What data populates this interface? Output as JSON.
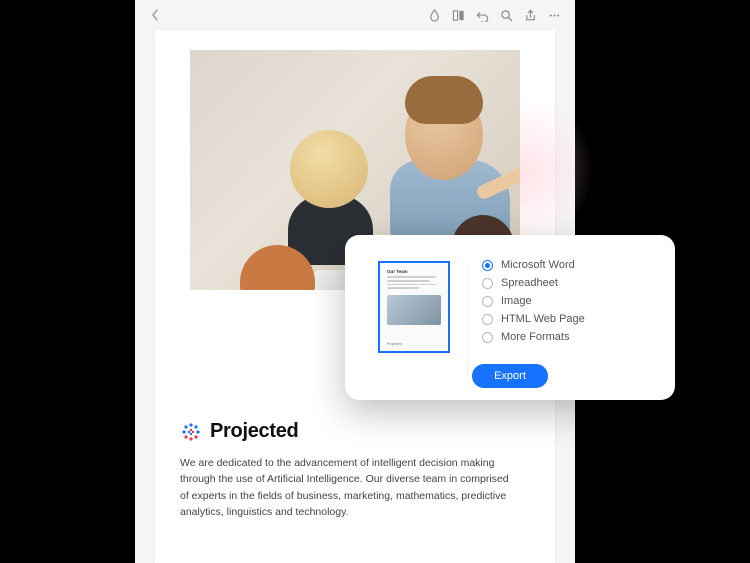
{
  "document": {
    "brand_name": "Projected",
    "body_text": "We are dedicated to the advancement of intelligent decision making through the use of Artificial Intelligence. Our diverse team in comprised of experts in the fields of business,  marketing, mathematics, predictive analytics, linguistics and technology."
  },
  "export_panel": {
    "thumbnail": {
      "title": "Our Team",
      "footer": "Projected"
    },
    "options": [
      {
        "label": "Microsoft Word",
        "selected": true
      },
      {
        "label": "Spreadheet",
        "selected": false
      },
      {
        "label": "Image",
        "selected": false
      },
      {
        "label": "HTML Web Page",
        "selected": false
      },
      {
        "label": "More Formats",
        "selected": false
      }
    ],
    "button_label": "Export"
  },
  "toolbar": {
    "icons": [
      "color-drop",
      "panels",
      "undo",
      "search",
      "share",
      "more"
    ]
  }
}
